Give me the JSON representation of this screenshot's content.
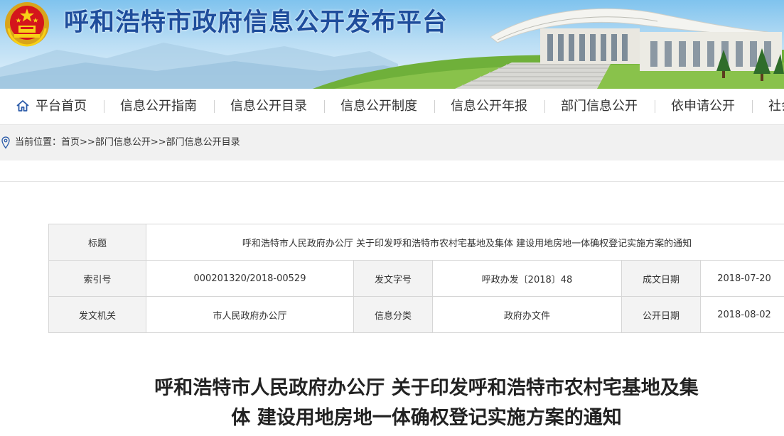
{
  "header": {
    "site_title": "呼和浩特市政府信息公开发布平台"
  },
  "nav": {
    "items": [
      {
        "label": "平台首页",
        "icon": "home-icon"
      },
      {
        "label": "信息公开指南"
      },
      {
        "label": "信息公开目录"
      },
      {
        "label": "信息公开制度"
      },
      {
        "label": "信息公开年报"
      },
      {
        "label": "部门信息公开"
      },
      {
        "label": "依申请公开"
      },
      {
        "label": "社会"
      }
    ]
  },
  "breadcrumb": {
    "prefix": "当前位置：",
    "items": [
      "首页",
      "部门信息公开",
      "部门信息公开目录"
    ],
    "separator": ">>",
    "icon": "location-pin-icon"
  },
  "meta_table": {
    "title_label": "标题",
    "title_value": "呼和浩特市人民政府办公厅 关于印发呼和浩特市农村宅基地及集体 建设用地房地一体确权登记实施方案的通知",
    "rows": [
      [
        {
          "label": "索引号",
          "value": "000201320/2018-00529"
        },
        {
          "label": "发文字号",
          "value": "呼政办发〔2018〕48"
        },
        {
          "label": "成文日期",
          "value": "2018-07-20"
        }
      ],
      [
        {
          "label": "发文机关",
          "value": "市人民政府办公厅"
        },
        {
          "label": "信息分类",
          "value": "政府办文件"
        },
        {
          "label": "公开日期",
          "value": "2018-08-02"
        }
      ]
    ]
  },
  "document": {
    "title_line1": "呼和浩特市人民政府办公厅 关于印发呼和浩特市农村宅基地及集",
    "title_line2": "体 建设用地房地一体确权登记实施方案的通知"
  },
  "colors": {
    "title_blue": "#1e4d9c",
    "nav_text": "#333333",
    "breadcrumb_bg": "#f1f1f1",
    "table_label_bg": "#f3f3f3"
  }
}
